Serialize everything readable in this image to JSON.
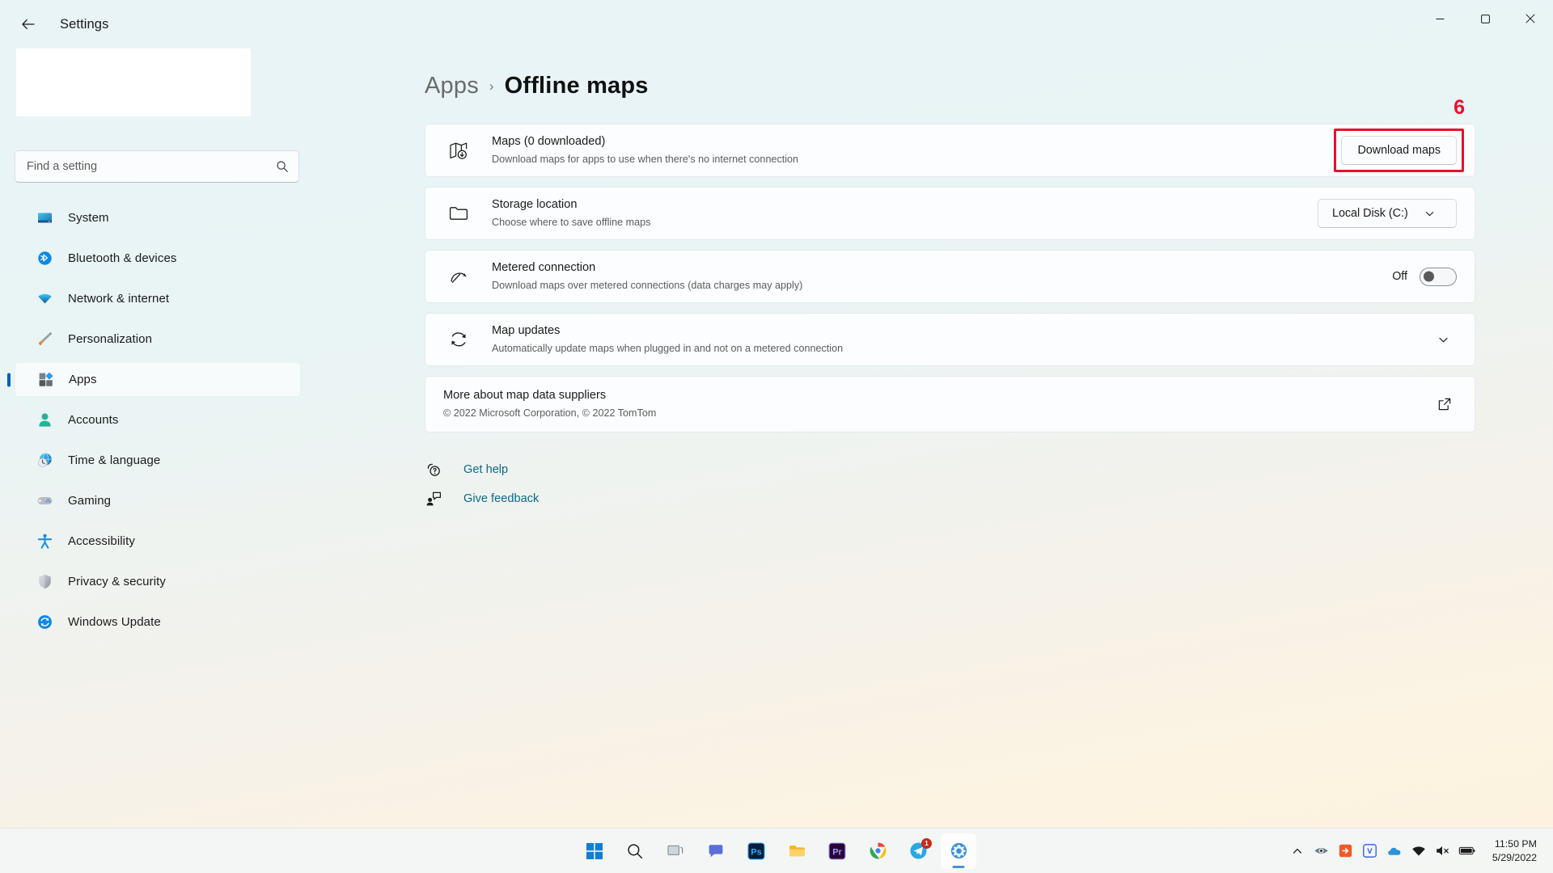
{
  "window": {
    "title": "Settings",
    "back_icon": "back-arrow-icon",
    "minimize_icon": "minimize-icon",
    "maximize_icon": "maximize-icon",
    "close_icon": "close-icon"
  },
  "search": {
    "placeholder": "Find a setting",
    "value": "",
    "icon": "search-icon"
  },
  "sidebar": {
    "items": [
      {
        "label": "System",
        "icon": "system-icon",
        "selected": false
      },
      {
        "label": "Bluetooth & devices",
        "icon": "bluetooth-icon",
        "selected": false
      },
      {
        "label": "Network & internet",
        "icon": "wifi-icon",
        "selected": false
      },
      {
        "label": "Personalization",
        "icon": "paintbrush-icon",
        "selected": false
      },
      {
        "label": "Apps",
        "icon": "apps-icon",
        "selected": true
      },
      {
        "label": "Accounts",
        "icon": "account-icon",
        "selected": false
      },
      {
        "label": "Time & language",
        "icon": "clock-globe-icon",
        "selected": false
      },
      {
        "label": "Gaming",
        "icon": "gamepad-icon",
        "selected": false
      },
      {
        "label": "Accessibility",
        "icon": "accessibility-icon",
        "selected": false
      },
      {
        "label": "Privacy & security",
        "icon": "shield-icon",
        "selected": false
      },
      {
        "label": "Windows Update",
        "icon": "update-icon",
        "selected": false
      }
    ]
  },
  "breadcrumb": {
    "parent": "Apps",
    "separator": "›",
    "current": "Offline maps"
  },
  "settings": {
    "maps": {
      "title": "Maps (0 downloaded)",
      "subtitle": "Download maps for apps to use when there's no internet connection",
      "icon": "map-download-icon",
      "button_label": "Download maps",
      "annotation_number": "6",
      "annotation_color": "#e8112d"
    },
    "storage": {
      "title": "Storage location",
      "subtitle": "Choose where to save offline maps",
      "icon": "folder-icon",
      "selected_value": "Local Disk (C:)",
      "chevron_icon": "chevron-down-icon"
    },
    "metered": {
      "title": "Metered connection",
      "subtitle": "Download maps over metered connections (data charges may apply)",
      "icon": "gauge-icon",
      "toggle_state": "Off",
      "toggle_on": false
    },
    "map_updates": {
      "title": "Map updates",
      "subtitle": "Automatically update maps when plugged in and not on a metered connection",
      "icon": "refresh-icon",
      "chevron_icon": "chevron-down-icon"
    },
    "suppliers": {
      "title": "More about map data suppliers",
      "subtitle": "© 2022 Microsoft Corporation, © 2022 TomTom",
      "external_icon": "external-link-icon"
    }
  },
  "footer": {
    "links": [
      {
        "label": "Get help",
        "icon": "help-icon"
      },
      {
        "label": "Give feedback",
        "icon": "feedback-icon"
      }
    ],
    "link_color": "#0b6a85"
  },
  "taskbar": {
    "apps": [
      {
        "name": "start-button",
        "icon": "windows-logo-icon",
        "active": false,
        "badge": ""
      },
      {
        "name": "search-button",
        "icon": "search-icon",
        "active": false,
        "badge": ""
      },
      {
        "name": "task-view-button",
        "icon": "task-view-icon",
        "active": false,
        "badge": ""
      },
      {
        "name": "chat-button",
        "icon": "chat-icon",
        "active": false,
        "badge": ""
      },
      {
        "name": "photoshop-button",
        "icon": "photoshop-icon",
        "active": false,
        "badge": ""
      },
      {
        "name": "file-explorer-button",
        "icon": "folder-icon",
        "active": false,
        "badge": ""
      },
      {
        "name": "premiere-button",
        "icon": "premiere-icon",
        "active": false,
        "badge": ""
      },
      {
        "name": "chrome-button",
        "icon": "chrome-icon",
        "active": false,
        "badge": ""
      },
      {
        "name": "telegram-button",
        "icon": "telegram-icon",
        "active": false,
        "badge": "1"
      },
      {
        "name": "settings-button",
        "icon": "gear-icon",
        "active": true,
        "badge": ""
      }
    ],
    "tray": [
      {
        "name": "show-hidden-icons",
        "icon": "chevron-up-icon"
      },
      {
        "name": "eye-tray-icon",
        "icon": "eye-icon"
      },
      {
        "name": "orange-tray-icon",
        "icon": "orange-square-icon"
      },
      {
        "name": "v-tray-icon",
        "icon": "letter-v-icon"
      },
      {
        "name": "onedrive-tray-icon",
        "icon": "cloud-icon"
      },
      {
        "name": "network-tray-icon",
        "icon": "wifi-icon"
      },
      {
        "name": "volume-tray-icon",
        "icon": "speaker-mute-icon"
      },
      {
        "name": "battery-tray-icon",
        "icon": "battery-icon"
      }
    ],
    "clock": {
      "time": "11:50 PM",
      "date": "5/29/2022"
    }
  },
  "theme": {
    "accent": "#005fb8",
    "card_bg": "#fbfdfe",
    "link": "#0b6a85"
  }
}
